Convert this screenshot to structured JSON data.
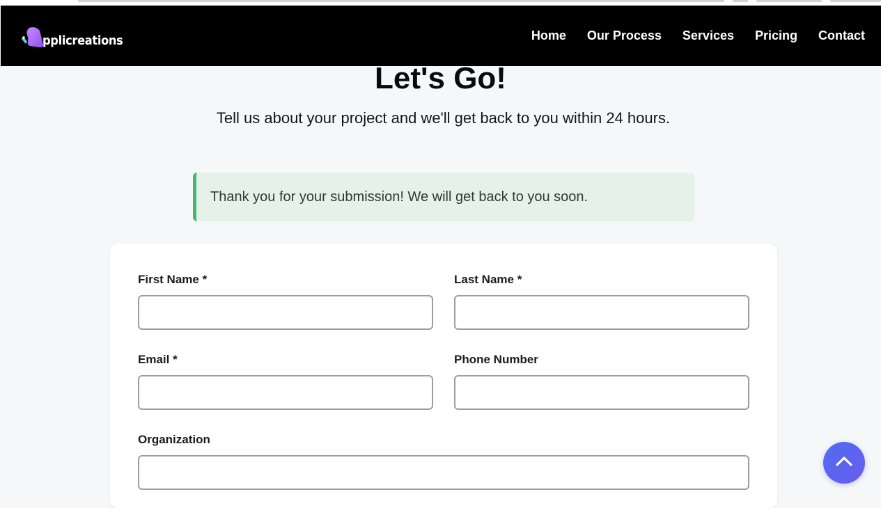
{
  "brand": {
    "name": "pplicreations",
    "logo_icon": "applicreations-logo-icon"
  },
  "nav": {
    "items": [
      {
        "label": "Home"
      },
      {
        "label": "Our Process"
      },
      {
        "label": "Services"
      },
      {
        "label": "Pricing"
      },
      {
        "label": "Contact"
      }
    ]
  },
  "hero": {
    "title": "Let's Go!",
    "subtitle": "Tell us about your project and we'll get back to you within 24 hours."
  },
  "alert": {
    "message": "Thank you for your submission! We will get back to you soon.",
    "accent_color": "#46b96c",
    "background_color": "#e5f2ea"
  },
  "form": {
    "first_name": {
      "label": "First Name *",
      "value": ""
    },
    "last_name": {
      "label": "Last Name *",
      "value": ""
    },
    "email": {
      "label": "Email *",
      "value": ""
    },
    "phone": {
      "label": "Phone Number",
      "value": ""
    },
    "organization": {
      "label": "Organization",
      "value": ""
    }
  },
  "scroll_top": {
    "icon": "chevron-up-icon",
    "color": "#5566f0"
  }
}
